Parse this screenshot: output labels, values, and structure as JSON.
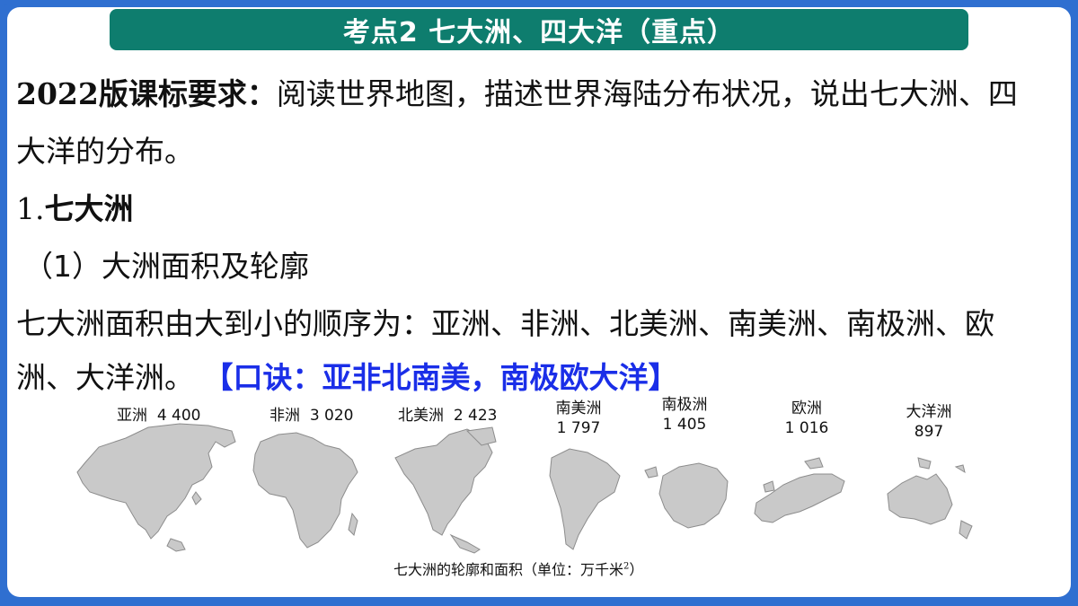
{
  "header": {
    "title": "考点2  七大洲、四大洋（重点）"
  },
  "requirement": {
    "label": "2022版课标要求：",
    "text_line1": "阅读世界地图，描述世界海陆分布状况，说出七大洲、四",
    "text_line2": "大洋的分布。"
  },
  "section": {
    "number": "1.",
    "title": "七大洲"
  },
  "subsection": {
    "title": "（1）大洲面积及轮廓"
  },
  "order": {
    "line1": "七大洲面积由大到小的顺序为：亚洲、非洲、北美洲、南美洲、南极洲、欧",
    "line2_prefix": "洲、大洋洲。",
    "mnemonic": "【口诀：亚非北南美，南极欧大洋】"
  },
  "continents": [
    {
      "name": "亚洲",
      "area": "4 400"
    },
    {
      "name": "非洲",
      "area": "3 020"
    },
    {
      "name": "北美洲",
      "area": "2 423"
    },
    {
      "name": "南美洲",
      "area": "1 797"
    },
    {
      "name": "南极洲",
      "area": "1 405"
    },
    {
      "name": "欧洲",
      "area": "1 016"
    },
    {
      "name": "大洋洲",
      "area": "897"
    }
  ],
  "figure": {
    "caption": "七大洲的轮廓和面积（单位：万千米",
    "caption_sup": "2",
    "caption_close": "）"
  },
  "colors": {
    "frame": "#2f6fd0",
    "title_bg": "#0e7d6e",
    "mnemonic": "#1a2ee8",
    "land": "#c9c9c9"
  }
}
